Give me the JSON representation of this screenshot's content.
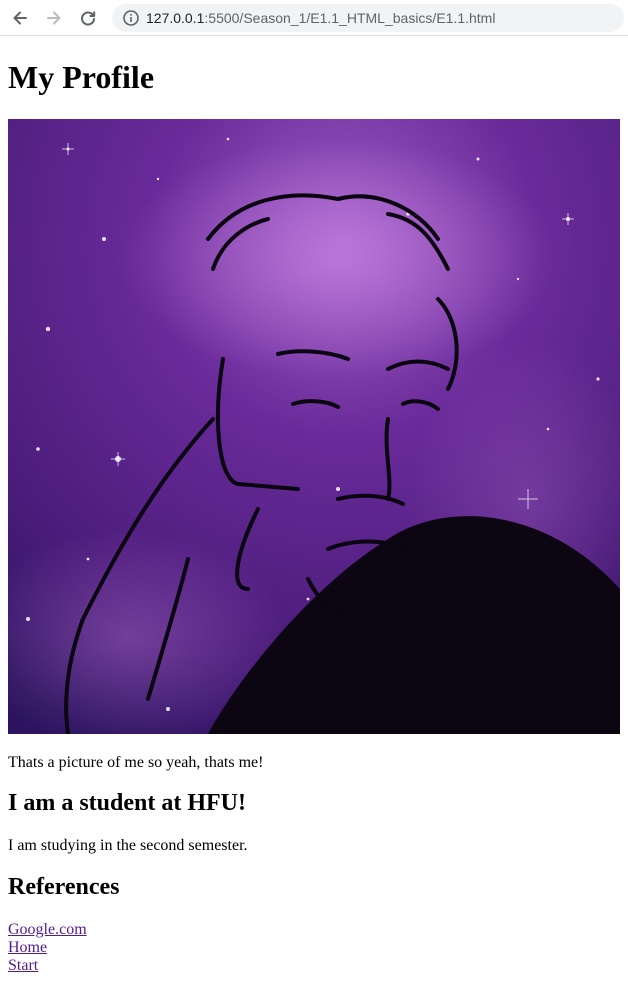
{
  "browser": {
    "url_host": "127.0.0.1",
    "url_path": ":5500/Season_1/E1.1_HTML_basics/E1.1.html",
    "icons": {
      "back": "arrow-left-icon",
      "forward": "arrow-right-icon",
      "reload": "reload-icon",
      "info": "info-icon"
    }
  },
  "page": {
    "title": "My Profile",
    "image": {
      "alt": "Profile picture",
      "style": "purple galaxy line-art portrait"
    },
    "caption": "Thats a picture of me so yeah, thats me!",
    "student_heading": "I am a student at HFU!",
    "study_text": "I am studying in the second semester.",
    "references_heading": "References",
    "links": [
      "Google.com",
      "Home",
      "Start"
    ]
  },
  "colors": {
    "link": "#551a8b",
    "toolbar_bg": "#ffffff",
    "omnibox_bg": "#f1f3f4",
    "galaxy": "#6a2b9a"
  }
}
